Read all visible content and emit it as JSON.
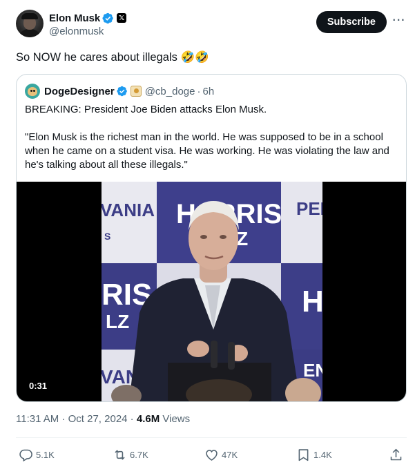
{
  "author": {
    "display_name": "Elon Musk",
    "handle": "@elonmusk",
    "x_badge": "𝕏",
    "avatar_icon": "profile-photo"
  },
  "header": {
    "subscribe_label": "Subscribe",
    "more_label": "···"
  },
  "tweet": {
    "text": "So NOW he cares about illegals ",
    "emoji": "🤣🤣"
  },
  "quote": {
    "display_name": "DogeDesigner",
    "handle": "@cb_doge",
    "separator": "·",
    "time": "6h",
    "line1": "BREAKING: President Joe Biden attacks Elon Musk.",
    "line2": "\"Elon Musk is the richest man in the world. He was supposed to be in a school when he came on a student visa. He was working. He was violating the law and he's talking about all these illegals.\"",
    "video": {
      "duration": "0:31",
      "backdrop_text": [
        "VANIA",
        "HARRIS",
        "LZ",
        "PEN",
        "RIS",
        "LZ",
        "VAN",
        "H",
        "EN",
        "S"
      ]
    }
  },
  "meta": {
    "time": "11:31 AM",
    "separator": " · ",
    "date": "Oct 27, 2024",
    "views_count": "4.6M",
    "views_label": " Views"
  },
  "actions": {
    "replies": "5.1K",
    "reposts": "6.7K",
    "likes": "47K",
    "bookmarks": "1.4K"
  },
  "colors": {
    "verified_blue": "#1d9bf0",
    "text_primary": "#0f1419",
    "text_secondary": "#536471",
    "border": "#cfd9de"
  }
}
